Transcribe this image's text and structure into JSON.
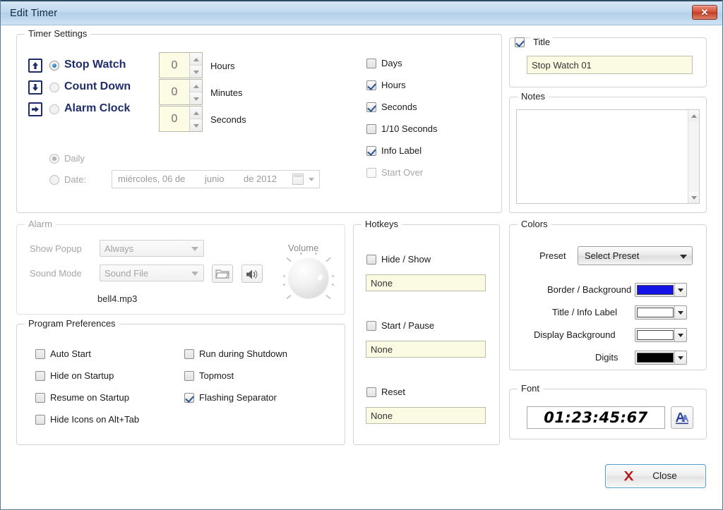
{
  "window": {
    "title": "Edit Timer",
    "close_icon": "window-close-x"
  },
  "timer_settings": {
    "legend": "Timer Settings",
    "modes": [
      {
        "label": "Stop Watch",
        "icon": "arrow-up-icon",
        "selected": true
      },
      {
        "label": "Count Down",
        "icon": "arrow-down-icon",
        "selected": false
      },
      {
        "label": "Alarm Clock",
        "icon": "arrow-right-icon",
        "selected": false
      }
    ],
    "spinners": [
      {
        "value": "0",
        "label": "Hours"
      },
      {
        "value": "0",
        "label": "Minutes"
      },
      {
        "value": "0",
        "label": "Seconds"
      }
    ],
    "display_options": [
      {
        "label": "Days",
        "checked": false,
        "disabled": false
      },
      {
        "label": "Hours",
        "checked": true,
        "disabled": false
      },
      {
        "label": "Seconds",
        "checked": true,
        "disabled": false
      },
      {
        "label": "1/10 Seconds",
        "checked": false,
        "disabled": false
      },
      {
        "label": "Info Label",
        "checked": true,
        "disabled": false
      },
      {
        "label": "Start Over",
        "checked": false,
        "disabled": true
      }
    ],
    "schedule": {
      "daily_label": "Daily",
      "daily_selected": true,
      "date_label": "Date:",
      "date_selected": false,
      "date_day": "miércoles, 06 de",
      "date_month": "junio",
      "date_year": "de 2012",
      "calendar_icon": "calendar-icon"
    }
  },
  "alarm": {
    "legend": "Alarm",
    "show_popup_label": "Show Popup",
    "show_popup_value": "Always",
    "sound_mode_label": "Sound Mode",
    "sound_mode_value": "Sound File",
    "browse_icon": "folder-open-icon",
    "play_icon": "speaker-icon",
    "sound_file": "bell4.mp3",
    "volume_label": "Volume",
    "volume_knob": "volume-knob"
  },
  "program_preferences": {
    "legend": "Program Preferences",
    "left_column": [
      {
        "label": "Auto Start",
        "checked": false
      },
      {
        "label": "Hide on Startup",
        "checked": false
      },
      {
        "label": "Resume on Startup",
        "checked": false
      },
      {
        "label": "Hide Icons on Alt+Tab",
        "checked": false
      }
    ],
    "right_column": [
      {
        "label": "Run during Shutdown",
        "checked": false
      },
      {
        "label": "Topmost",
        "checked": false
      },
      {
        "label": "Flashing Separator",
        "checked": true
      }
    ]
  },
  "hotkeys": {
    "legend": "Hotkeys",
    "items": [
      {
        "label": "Hide / Show",
        "checked": false,
        "value": "None"
      },
      {
        "label": "Start / Pause",
        "checked": false,
        "value": "None"
      },
      {
        "label": "Reset",
        "checked": false,
        "value": "None"
      }
    ]
  },
  "title_group": {
    "legend": "Title",
    "checked": true,
    "value": "Stop Watch 01"
  },
  "notes": {
    "legend": "Notes",
    "value": "",
    "scroll_up_icon": "scroll-up-arrow-icon",
    "scroll_down_icon": "scroll-down-arrow-icon"
  },
  "colors": {
    "legend": "Colors",
    "preset_label": "Preset",
    "preset_value": "Select Preset",
    "rows": [
      {
        "label": "Border / Background",
        "color": "#1414e6"
      },
      {
        "label": "Title / Info Label",
        "color": "#ffffff"
      },
      {
        "label": "Display Background",
        "color": "#ffffff"
      },
      {
        "label": "Digits",
        "color": "#000000"
      }
    ]
  },
  "font": {
    "legend": "Font",
    "preview": "01:23:45:67",
    "picker_icon": "font-picker-icon"
  },
  "footer": {
    "close_label": "Close",
    "close_icon": "red-x-icon"
  }
}
